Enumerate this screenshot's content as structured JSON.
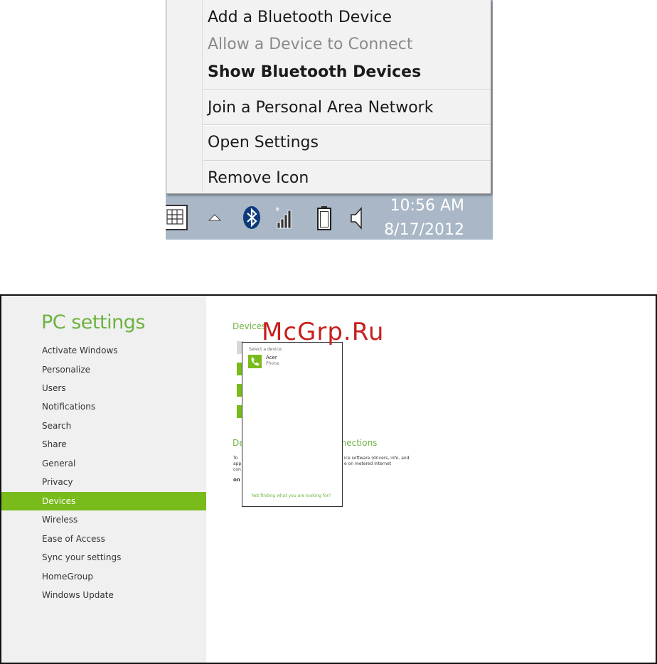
{
  "context_menu": {
    "items": [
      {
        "label": "Add a Bluetooth Device"
      },
      {
        "label": "Allow a Device to Connect"
      },
      {
        "label": "Show Bluetooth Devices"
      },
      {
        "label": "Join a Personal Area Network"
      },
      {
        "label": "Open Settings"
      },
      {
        "label": "Remove Icon"
      }
    ]
  },
  "taskbar": {
    "time": "10:56 AM",
    "date": "8/17/2012",
    "icons": [
      "keyboard-icon",
      "show-hidden-icons-arrow",
      "bluetooth-icon",
      "network-signal-icon",
      "battery-icon",
      "speaker-icon"
    ]
  },
  "pc_settings": {
    "title": "PC settings",
    "nav": [
      {
        "label": "Activate Windows"
      },
      {
        "label": "Personalize"
      },
      {
        "label": "Users"
      },
      {
        "label": "Notifications"
      },
      {
        "label": "Search"
      },
      {
        "label": "Share"
      },
      {
        "label": "General"
      },
      {
        "label": "Privacy"
      },
      {
        "label": "Devices"
      },
      {
        "label": "Wireless"
      },
      {
        "label": "Ease of Access"
      },
      {
        "label": "Sync your settings"
      },
      {
        "label": "HomeGroup"
      },
      {
        "label": "Windows Update"
      }
    ],
    "active_nav": "Devices",
    "content": {
      "heading": "Devices",
      "section_heading_left": "De",
      "section_heading_right": "nnections",
      "text_left_1": "To",
      "text_left_2": "app",
      "text_left_3": "con",
      "text_left_4": "on",
      "text_right_1": "ice software (drivers, info, and",
      "text_right_2": "e on metered Internet"
    },
    "device_popup": {
      "title": "Select a device:",
      "device_name": "Acer",
      "device_type": "Phone",
      "footer_link": "Not finding what you are looking for?"
    }
  },
  "watermark": "McGrp.Ru",
  "colors": {
    "accent_green": "#78bb1a",
    "title_green": "#6db33f",
    "watermark_red": "#c81e1e",
    "taskbar_blue": "#a9b7c6"
  }
}
